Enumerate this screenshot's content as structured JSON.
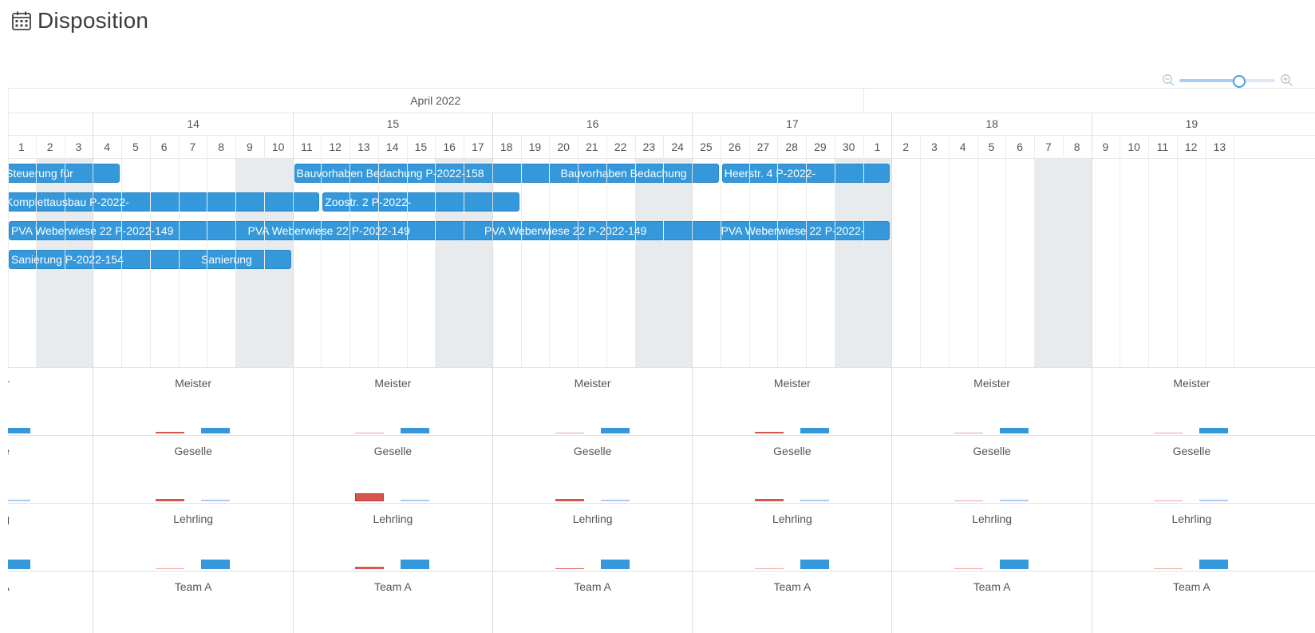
{
  "header": {
    "title": "Disposition",
    "icon": "calendar-icon"
  },
  "zoom": {
    "out_icon": "zoom-out-icon",
    "in_icon": "zoom-in-icon",
    "level": 0.62
  },
  "timeline": {
    "month": "April 2022",
    "weeks": [
      "14",
      "15",
      "16",
      "17",
      "18",
      "19"
    ],
    "days": [
      "1",
      "2",
      "3",
      "4",
      "5",
      "6",
      "7",
      "8",
      "9",
      "10",
      "11",
      "12",
      "13",
      "14",
      "15",
      "16",
      "17",
      "18",
      "19",
      "20",
      "21",
      "22",
      "23",
      "24",
      "25",
      "26",
      "27",
      "28",
      "29",
      "30",
      "1",
      "2",
      "3",
      "4",
      "5",
      "6",
      "7",
      "8",
      "9",
      "10",
      "11",
      "12",
      "13"
    ]
  },
  "events": [
    {
      "name": "event-steuerung",
      "labels": [
        "Steuerung für"
      ],
      "start": 0,
      "end": 3,
      "row": 0
    },
    {
      "name": "event-bauvorhaben-bedachung",
      "labels": [
        "Bauvorhaben Bedachung P-2022-158",
        "Bauvorhaben Bedachung"
      ],
      "start": 10,
      "end": 24,
      "row": 0
    },
    {
      "name": "event-heerstr-4",
      "labels": [
        "Heerstr. 4 P-2022-"
      ],
      "start": 25,
      "end": 30,
      "row": 0
    },
    {
      "name": "event-komplettausbau",
      "labels": [
        "Komplettausbau P-2022-"
      ],
      "start": 0,
      "end": 10,
      "row": 1
    },
    {
      "name": "event-zoostr-2",
      "labels": [
        "Zoostr. 2 P-2022-"
      ],
      "start": 11,
      "end": 17,
      "row": 1
    },
    {
      "name": "event-pva-weberwiese",
      "labels": [
        "PVA Weberwiese 22 P-2022-149",
        "PVA Weberwiese 22 P-2022-149",
        "PVA Weberwiese 22 P-2022-149",
        "PVA Weberwiese 22 P-2022-"
      ],
      "start": 0,
      "end": 30,
      "row": 2
    },
    {
      "name": "event-sanierung",
      "labels": [
        "Sanierung P-2022-154",
        "Sanierung"
      ],
      "start": 0,
      "end": 9,
      "row": 3
    }
  ],
  "resources": [
    {
      "name": "Meister",
      "cut_label": "er",
      "first_blue": 0.35,
      "weeks": [
        {
          "red": 0.12,
          "blue": 0.35
        },
        {
          "red": 0.05,
          "blue": 0.35
        },
        {
          "red": 0.05,
          "blue": 0.35
        },
        {
          "red": 0.12,
          "blue": 0.35
        },
        {
          "red": 0.06,
          "blue": 0.35
        },
        {
          "red": 0.06,
          "blue": 0.35
        }
      ]
    },
    {
      "name": "Geselle",
      "cut_label": "le",
      "first_blue": 0.1,
      "weeks": [
        {
          "red": 0.25,
          "blue": 0.1
        },
        {
          "red": 0.7,
          "blue": 0.1
        },
        {
          "red": 0.25,
          "blue": 0.1
        },
        {
          "red": 0.2,
          "blue": 0.1
        },
        {
          "red": 0.08,
          "blue": 0.1
        },
        {
          "red": 0.08,
          "blue": 0.1
        }
      ]
    },
    {
      "name": "Lehrling",
      "cut_label": "ng",
      "first_blue": 0.6,
      "weeks": [
        {
          "red": 0.08,
          "blue": 0.6
        },
        {
          "red": 0.25,
          "blue": 0.6
        },
        {
          "red": 0.1,
          "blue": 0.6
        },
        {
          "red": 0.06,
          "blue": 0.6
        },
        {
          "red": 0.06,
          "blue": 0.6
        },
        {
          "red": 0.06,
          "blue": 0.6
        }
      ]
    },
    {
      "name": "Team A",
      "cut_label": "A",
      "first_blue": 0,
      "weeks": [
        {
          "red": 0,
          "blue": 0
        },
        {
          "red": 0,
          "blue": 0
        },
        {
          "red": 0,
          "blue": 0
        },
        {
          "red": 0,
          "blue": 0
        },
        {
          "red": 0,
          "blue": 0
        },
        {
          "red": 0,
          "blue": 0
        }
      ]
    }
  ],
  "colors": {
    "event": "#3498db",
    "bar_blue": "#3498db",
    "bar_red": "#d9534f",
    "weekend": "#e8ebee"
  }
}
